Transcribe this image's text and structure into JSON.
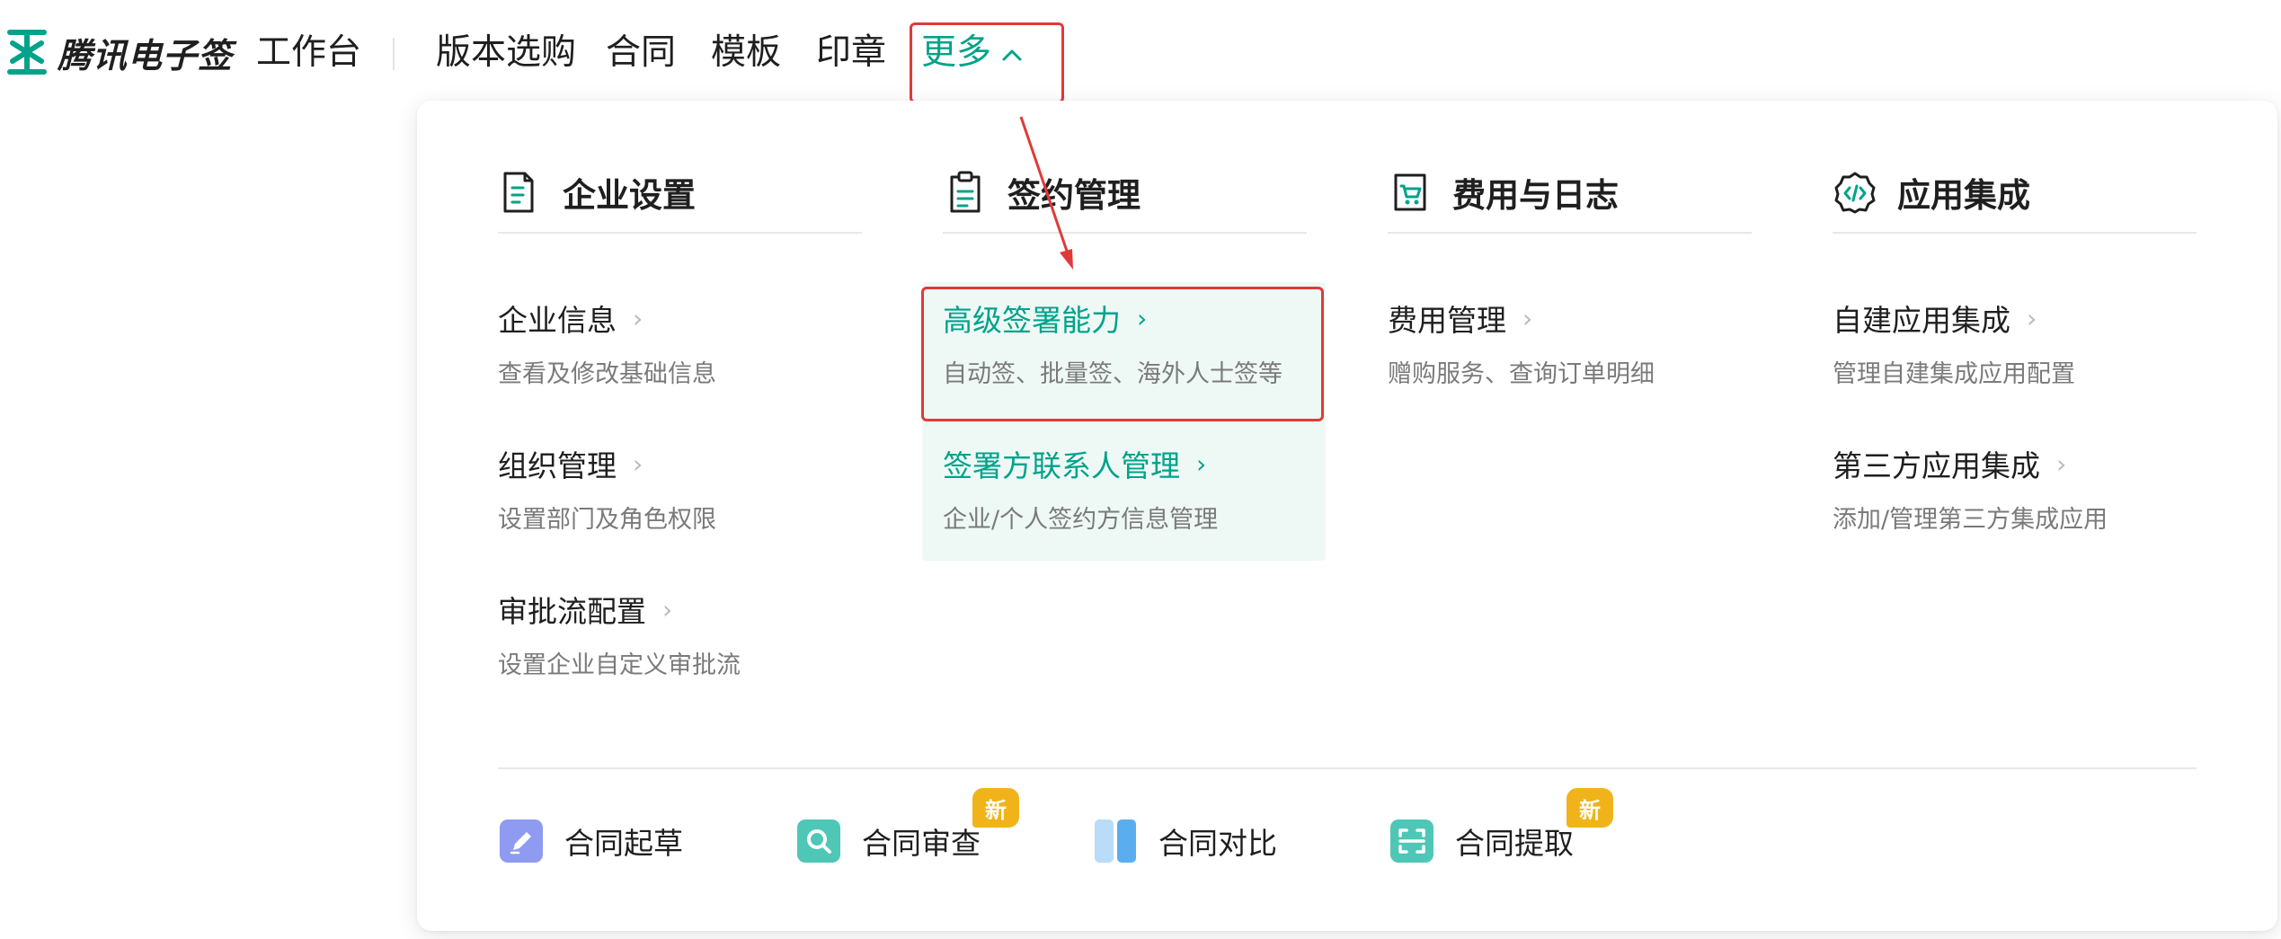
{
  "brand": {
    "name": "腾讯电子签",
    "color": "#00a38a"
  },
  "nav": {
    "items": [
      "工作台",
      "版本选购",
      "合同",
      "模板",
      "印章"
    ],
    "more_label": "更多"
  },
  "menu": {
    "columns": [
      {
        "title": "企业设置",
        "icon": "document-icon",
        "entries": [
          {
            "title": "企业信息",
            "desc": "查看及修改基础信息"
          },
          {
            "title": "组织管理",
            "desc": "设置部门及角色权限"
          },
          {
            "title": "审批流配置",
            "desc": "设置企业自定义审批流"
          }
        ]
      },
      {
        "title": "签约管理",
        "icon": "clipboard-icon",
        "entries": [
          {
            "title": "高级签署能力",
            "desc": "自动签、批量签、海外人士签等"
          },
          {
            "title": "签署方联系人管理",
            "desc": "企业/个人签约方信息管理"
          }
        ]
      },
      {
        "title": "费用与日志",
        "icon": "cart-icon",
        "entries": [
          {
            "title": "费用管理",
            "desc": "赠购服务、查询订单明细"
          }
        ]
      },
      {
        "title": "应用集成",
        "icon": "code-gear-icon",
        "entries": [
          {
            "title": "自建应用集成",
            "desc": "管理自建集成应用配置"
          },
          {
            "title": "第三方应用集成",
            "desc": "添加/管理第三方集成应用"
          }
        ]
      }
    ],
    "tools": [
      {
        "label": "合同起草",
        "icon": "pen-icon",
        "color": "#8e9bf0"
      },
      {
        "label": "合同审查",
        "icon": "magnifier-icon",
        "color": "#4fc7b7",
        "badge": "新"
      },
      {
        "label": "合同对比",
        "icon": "compare-icon",
        "color": "#5aaef0"
      },
      {
        "label": "合同提取",
        "icon": "scan-icon",
        "color": "#4fc7b7",
        "badge": "新"
      }
    ]
  },
  "colors": {
    "accent": "#00a38a",
    "annotation": "#e03a3a",
    "badge": "#f0b31a"
  }
}
